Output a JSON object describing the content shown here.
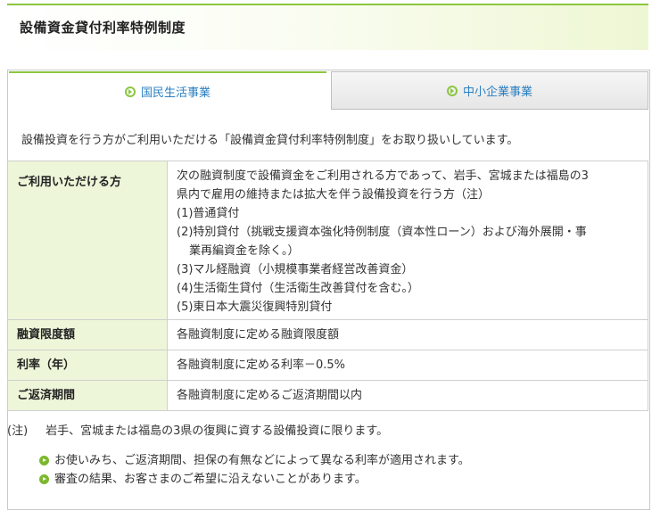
{
  "header": {
    "title": "設備資金貸付利率特例制度"
  },
  "tabs": [
    {
      "label": "国民生活事業",
      "active": true
    },
    {
      "label": "中小企業事業",
      "active": false
    }
  ],
  "intro": "設備投資を行う方がご利用いただける「設備資金貸付利率特例制度」をお取り扱いしています。",
  "table": {
    "eligible": {
      "label": "ご利用いただける方",
      "lines": [
        "次の融資制度で設備資金をご利用される方であって、岩手、宮城または福島の3",
        "県内で雇用の維持または拡大を伴う設備投資を行う方（注）",
        "(1)普通貸付",
        "(2)特別貸付（挑戦支援資本強化特例制度（資本性ローン）および海外展開・事",
        "業再編資金を除く。）",
        "(3)マル経融資（小規模事業者経営改善資金）",
        "(4)生活衛生貸付（生活衛生改善貸付を含む。）",
        "(5)東日本大震災復興特別貸付"
      ]
    },
    "limit": {
      "label": "融資限度額",
      "value": "各融資制度に定める融資限度額"
    },
    "rate": {
      "label": "利率（年）",
      "value": "各融資制度に定める利率－0.5%"
    },
    "period": {
      "label": "ご返済期間",
      "value": "各融資制度に定めるご返済期間以内"
    }
  },
  "note": {
    "mark": "(注)",
    "text": "岩手、宮城または福島の3県の復興に資する設備投資に限ります。"
  },
  "bullets": [
    "お使いみち、ご返済期間、担保の有無などによって異なる利率が適用されます。",
    "審査の結果、お客さまのご希望に沿えないことがあります。"
  ],
  "colors": {
    "accent": "#8cc63f",
    "link": "#2a7fc1",
    "header_cell": "#eef6d9"
  },
  "icons": {
    "tab": "circle-arrow-icon",
    "bullet": "green-arrow-bullet-icon"
  }
}
